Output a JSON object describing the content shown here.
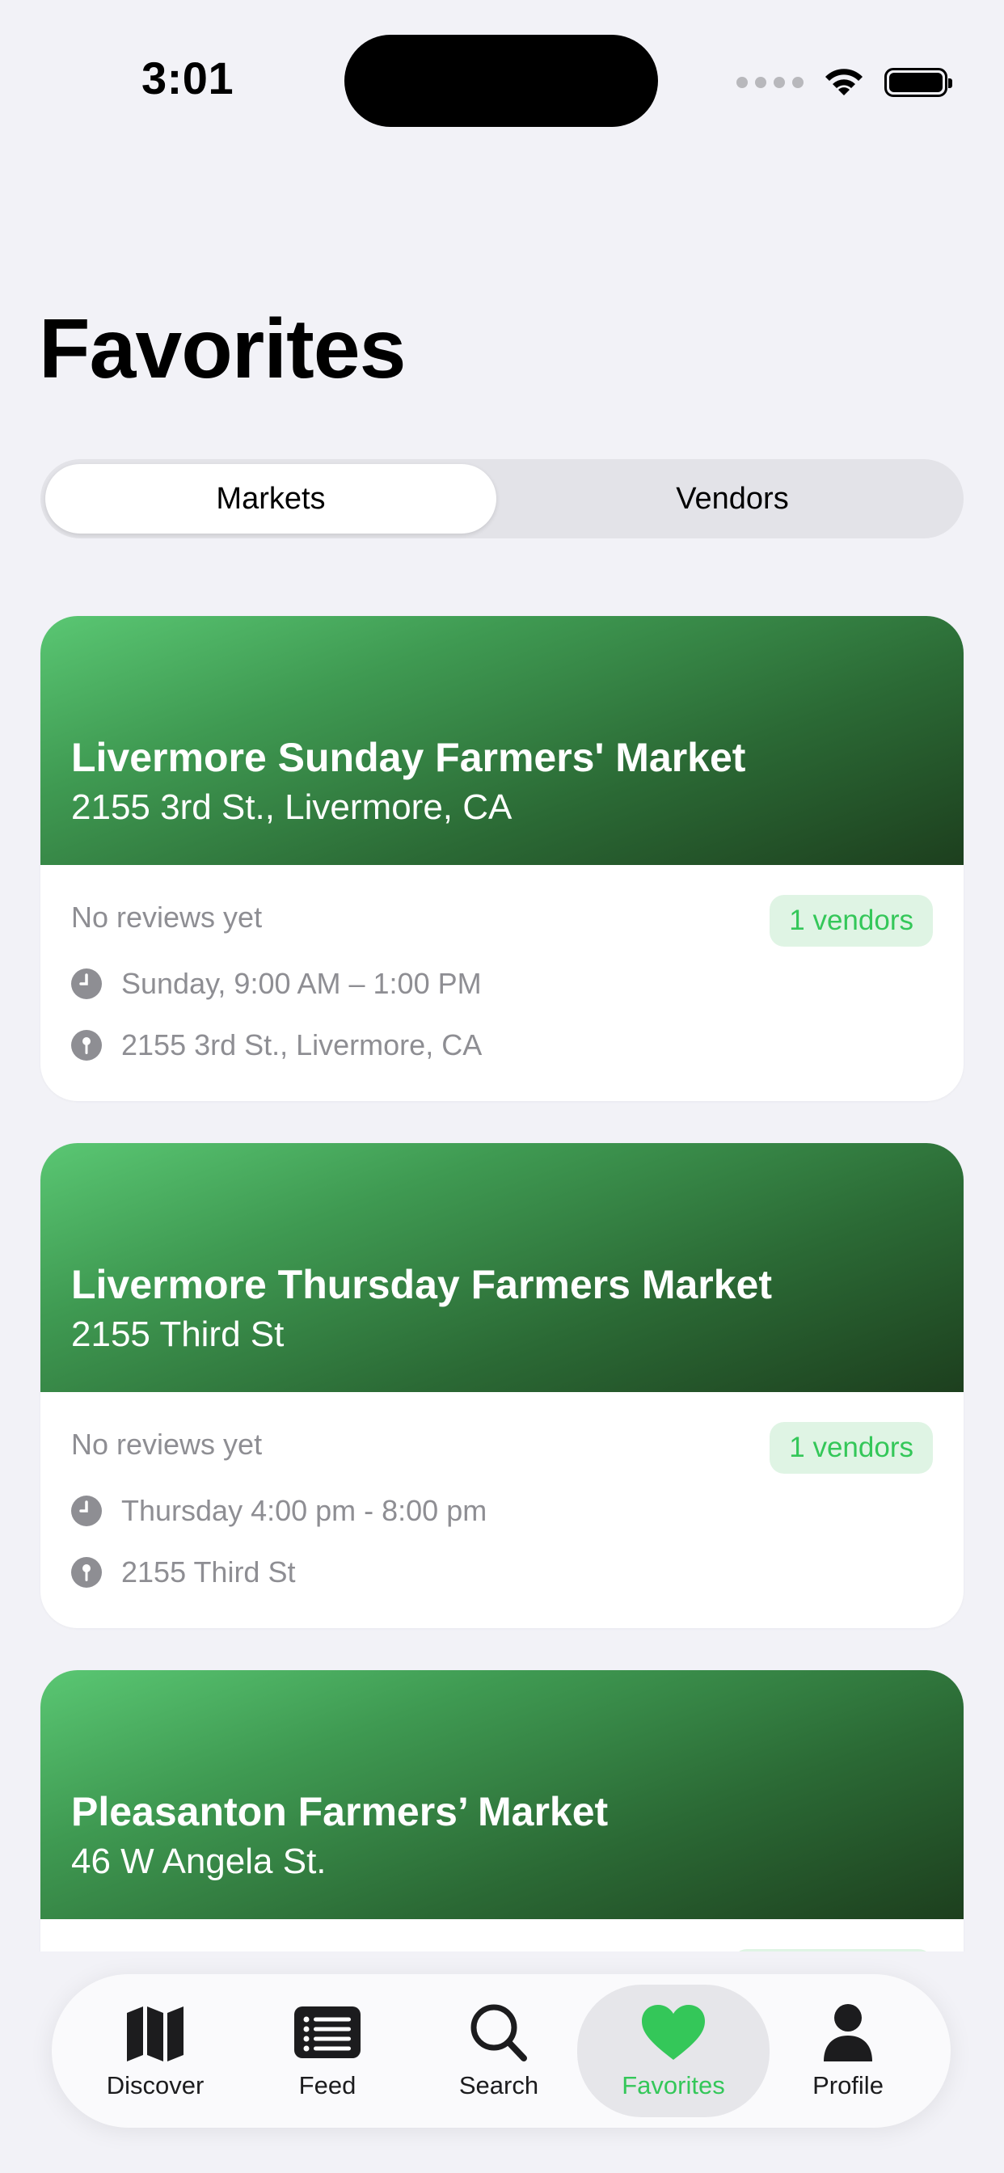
{
  "status_bar": {
    "time": "3:01"
  },
  "page": {
    "title": "Favorites"
  },
  "segmented": {
    "markets_label": "Markets",
    "vendors_label": "Vendors",
    "selected": "Markets"
  },
  "markets": [
    {
      "name": "Livermore Sunday Farmers' Market",
      "address": "2155 3rd St., Livermore, CA",
      "reviews": "No reviews yet",
      "vendors": "1 vendors",
      "hours": "Sunday, 9:00 AM – 1:00 PM",
      "location": "2155 3rd St., Livermore, CA"
    },
    {
      "name": "Livermore Thursday Farmers Market",
      "address": "2155 Third St",
      "reviews": "No reviews yet",
      "vendors": "1 vendors",
      "hours": "Thursday 4:00 pm - 8:00 pm",
      "location": "2155 Third St"
    },
    {
      "name": "Pleasanton Farmers’ Market",
      "address": "46 W Angela St."
    }
  ],
  "tabbar": {
    "items": [
      {
        "label": "Discover",
        "icon": "map-icon"
      },
      {
        "label": "Feed",
        "icon": "list-icon"
      },
      {
        "label": "Search",
        "icon": "magnifier-icon"
      },
      {
        "label": "Favorites",
        "icon": "heart-icon"
      },
      {
        "label": "Profile",
        "icon": "person-icon"
      }
    ],
    "active": "Favorites"
  },
  "colors": {
    "accent": "#34c759",
    "background": "#f2f2f7",
    "header_dark": "#1d3f1e"
  }
}
